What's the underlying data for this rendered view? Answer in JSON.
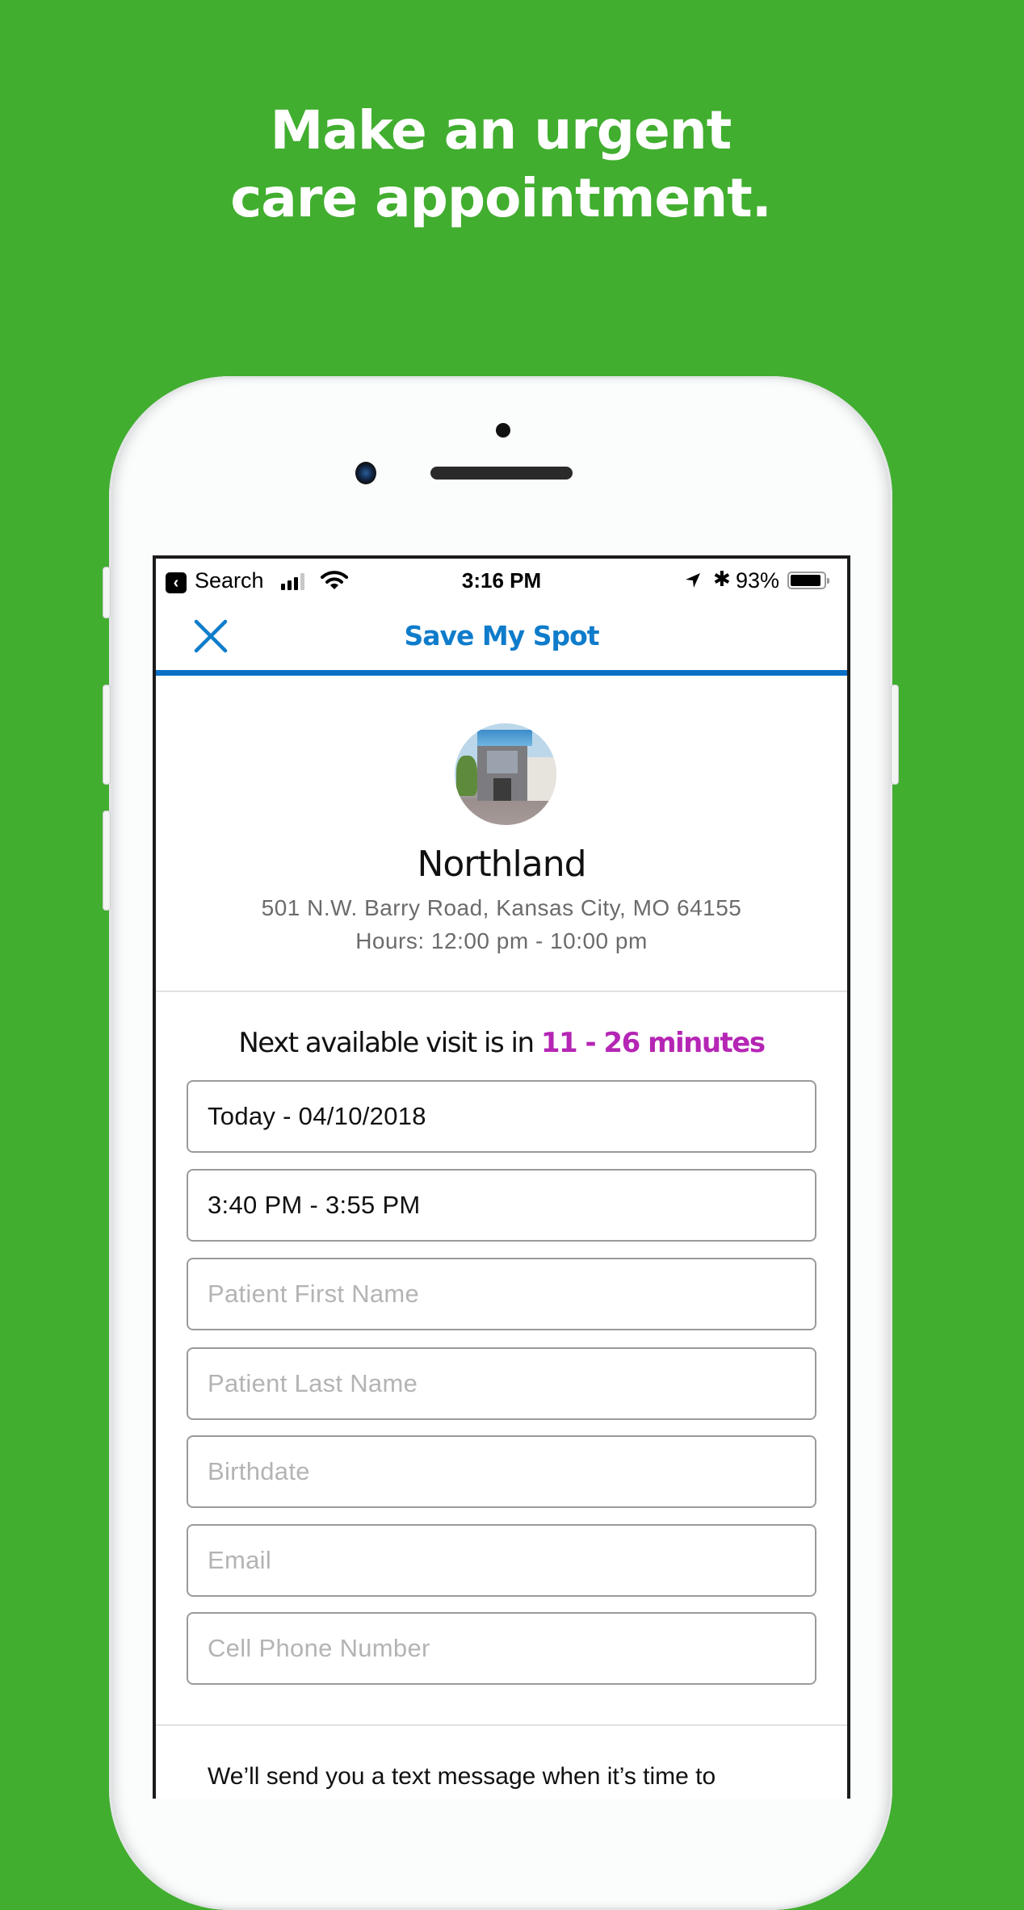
{
  "headline": {
    "line1": "Make an urgent",
    "line2": "care appointment."
  },
  "status_bar": {
    "back_app": "Search",
    "time": "3:16 PM",
    "battery_percent": "93%",
    "battery_level": 0.93,
    "signal_bars": 3,
    "signal_total": 4,
    "icons": [
      "back-arrow-icon",
      "signal-icon",
      "wifi-icon",
      "location-arrow-icon",
      "bluetooth-icon",
      "battery-icon"
    ]
  },
  "navbar": {
    "title": "Save My Spot",
    "close_icon": "close-icon"
  },
  "colors": {
    "background": "#41ae2f",
    "brand_blue": "#0f7ccb",
    "accent_magenta": "#b526b5"
  },
  "location": {
    "name": "Northland",
    "address": "501 N.W. Barry Road, Kansas City, MO 64155",
    "hours": "Hours: 12:00 pm - 10:00 pm"
  },
  "availability": {
    "prefix": "Next available visit is in ",
    "highlight": "11 - 26 minutes"
  },
  "form": {
    "date": {
      "value": "Today - 04/10/2018",
      "placeholder": ""
    },
    "time": {
      "value": "3:40 PM - 3:55 PM",
      "placeholder": ""
    },
    "first_name": {
      "value": "",
      "placeholder": "Patient First Name"
    },
    "last_name": {
      "value": "",
      "placeholder": "Patient Last Name"
    },
    "birthdate": {
      "value": "",
      "placeholder": "Birthdate"
    },
    "email": {
      "value": "",
      "placeholder": "Email"
    },
    "phone": {
      "value": "",
      "placeholder": "Cell Phone Number"
    }
  },
  "footer": {
    "text": "We’ll send you a text message when it’s time to"
  }
}
